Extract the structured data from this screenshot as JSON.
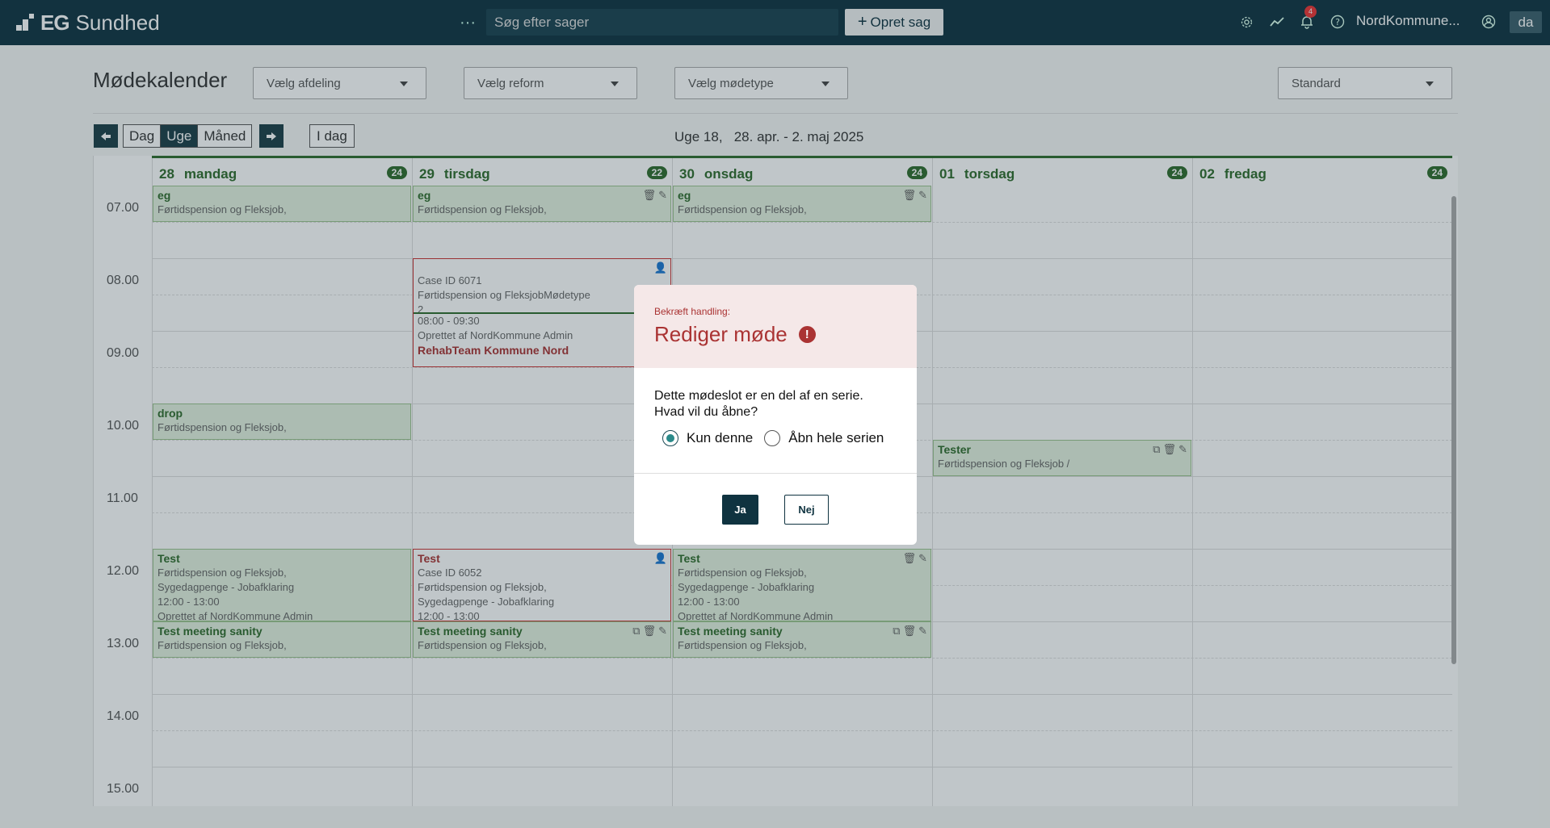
{
  "header": {
    "logo_eg": "EG",
    "logo_name": "Sundhed",
    "search_placeholder": "Søg efter sager",
    "new_case_label": "Opret sag",
    "notification_count": "4",
    "org_name": "NordKommune...",
    "lang": "da"
  },
  "toolbar": {
    "title": "Mødekalender",
    "department_placeholder": "Vælg afdeling",
    "reform_placeholder": "Vælg reform",
    "meeting_type_placeholder": "Vælg mødetype",
    "view_preset": "Standard"
  },
  "nav": {
    "views": [
      "Dag",
      "Uge",
      "Måned"
    ],
    "active_view": "Uge",
    "today_label": "I dag",
    "week_label": "Uge 18,   28. apr. - 2. maj 2025"
  },
  "days": [
    {
      "num": "28",
      "name": "mandag",
      "count": "24"
    },
    {
      "num": "29",
      "name": "tirsdag",
      "count": "22"
    },
    {
      "num": "30",
      "name": "onsdag",
      "count": "24"
    },
    {
      "num": "01",
      "name": "torsdag",
      "count": "24"
    },
    {
      "num": "02",
      "name": "fredag",
      "count": "24"
    }
  ],
  "times": [
    "07.00",
    "08.00",
    "09.00",
    "10.00",
    "11.00",
    "12.00",
    "13.00",
    "14.00",
    "15.00"
  ],
  "events": {
    "mon_eg": {
      "title": "eg",
      "line1": "Førtidspension og Fleksjob,"
    },
    "tue_eg": {
      "title": "eg",
      "line1": "Førtidspension og Fleksjob,"
    },
    "wed_eg": {
      "title": "eg",
      "line1": "Førtidspension og Fleksjob,"
    },
    "tue_case": {
      "line1": "Case ID 6071",
      "line2": "Førtidspension og FleksjobMødetype",
      "line3": "2",
      "line4": "08:00 - 09:30",
      "line5": "Oprettet af NordKommune Admin",
      "team": "RehabTeam Kommune Nord"
    },
    "mon_drop": {
      "title": "drop",
      "line1": "Førtidspension og Fleksjob,"
    },
    "thu_tester": {
      "title": "Tester",
      "line1": "Førtidspension og Fleksjob /"
    },
    "mon_test": {
      "title": "Test",
      "line1": "Førtidspension og Fleksjob,",
      "line2": "Sygedagpenge - Jobafklaring",
      "line3": "12:00 - 13:00",
      "line4": "Oprettet af NordKommune Admin"
    },
    "tue_test": {
      "title": "Test",
      "line1": "Case ID 6052",
      "line2": "Førtidspension og Fleksjob,",
      "line3": "Sygedagpenge - Jobafklaring",
      "line4": "12:00 - 13:00"
    },
    "wed_test": {
      "title": "Test",
      "line1": "Førtidspension og Fleksjob,",
      "line2": "Sygedagpenge - Jobafklaring",
      "line3": "12:00 - 13:00",
      "line4": "Oprettet af NordKommune Admin"
    },
    "mon_sanity": {
      "title": "Test meeting sanity",
      "line1": "Førtidspension og Fleksjob,"
    },
    "tue_sanity": {
      "title": "Test meeting sanity",
      "line1": "Førtidspension og Fleksjob,"
    },
    "wed_sanity": {
      "title": "Test meeting sanity",
      "line1": "Førtidspension og Fleksjob,"
    }
  },
  "modal": {
    "pre_title": "Bekræft handling:",
    "title": "Rediger møde",
    "message_line1": "Dette mødeslot er en del af en serie.",
    "message_line2": "Hvad vil du åbne?",
    "option_only": "Kun denne",
    "option_series": "Åbn hele serien",
    "selected": "Kun denne",
    "yes_label": "Ja",
    "no_label": "Nej"
  },
  "colors": {
    "topbar": "#0f3340",
    "accent_green": "#2f6b2b",
    "alert_red": "#aa3333"
  }
}
